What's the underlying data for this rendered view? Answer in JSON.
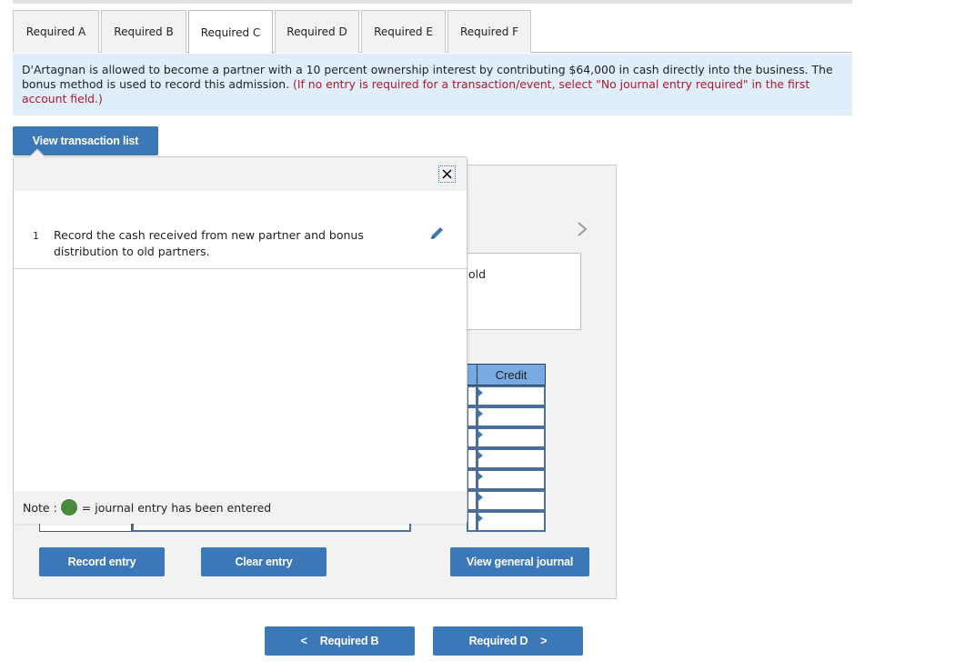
{
  "tabs": [
    {
      "label": "Required A",
      "active": false
    },
    {
      "label": "Required B",
      "active": false
    },
    {
      "label": "Required C",
      "active": true
    },
    {
      "label": "Required D",
      "active": false
    },
    {
      "label": "Required E",
      "active": false
    },
    {
      "label": "Required F",
      "active": false
    }
  ],
  "prompt": {
    "text": "D'Artagnan is allowed to become a partner with a 10 percent ownership interest by contributing $64,000 in cash directly into the business. The bonus method is used to record this admission.",
    "instruction": "(If no entry is required for a transaction/event, select \"No journal entry required\" in the first account field.)"
  },
  "view_transaction_list_label": "View transaction list",
  "popover": {
    "close_symbol": "×",
    "transactions": [
      {
        "number": "1",
        "text": "Record the cash received from new partner and bonus distribution to old partners."
      }
    ],
    "note_prefix": "Note :",
    "note_suffix": "= journal entry has been entered",
    "note_color": "#4a8a3c"
  },
  "journal": {
    "description_visible_text": "old",
    "credit_header": "Credit",
    "row_count": 7
  },
  "buttons": {
    "record_entry": "Record entry",
    "clear_entry": "Clear entry",
    "view_general_journal": "View general journal"
  },
  "nav": {
    "prev_label": "Required B",
    "next_label": "Required D",
    "prev_symbol": "<",
    "next_symbol": ">"
  },
  "colors": {
    "accent": "#3c78b8",
    "prompt_bg": "#dfeefa",
    "instruction_red": "#b0182b",
    "credit_header_bg": "#78a9e0"
  }
}
